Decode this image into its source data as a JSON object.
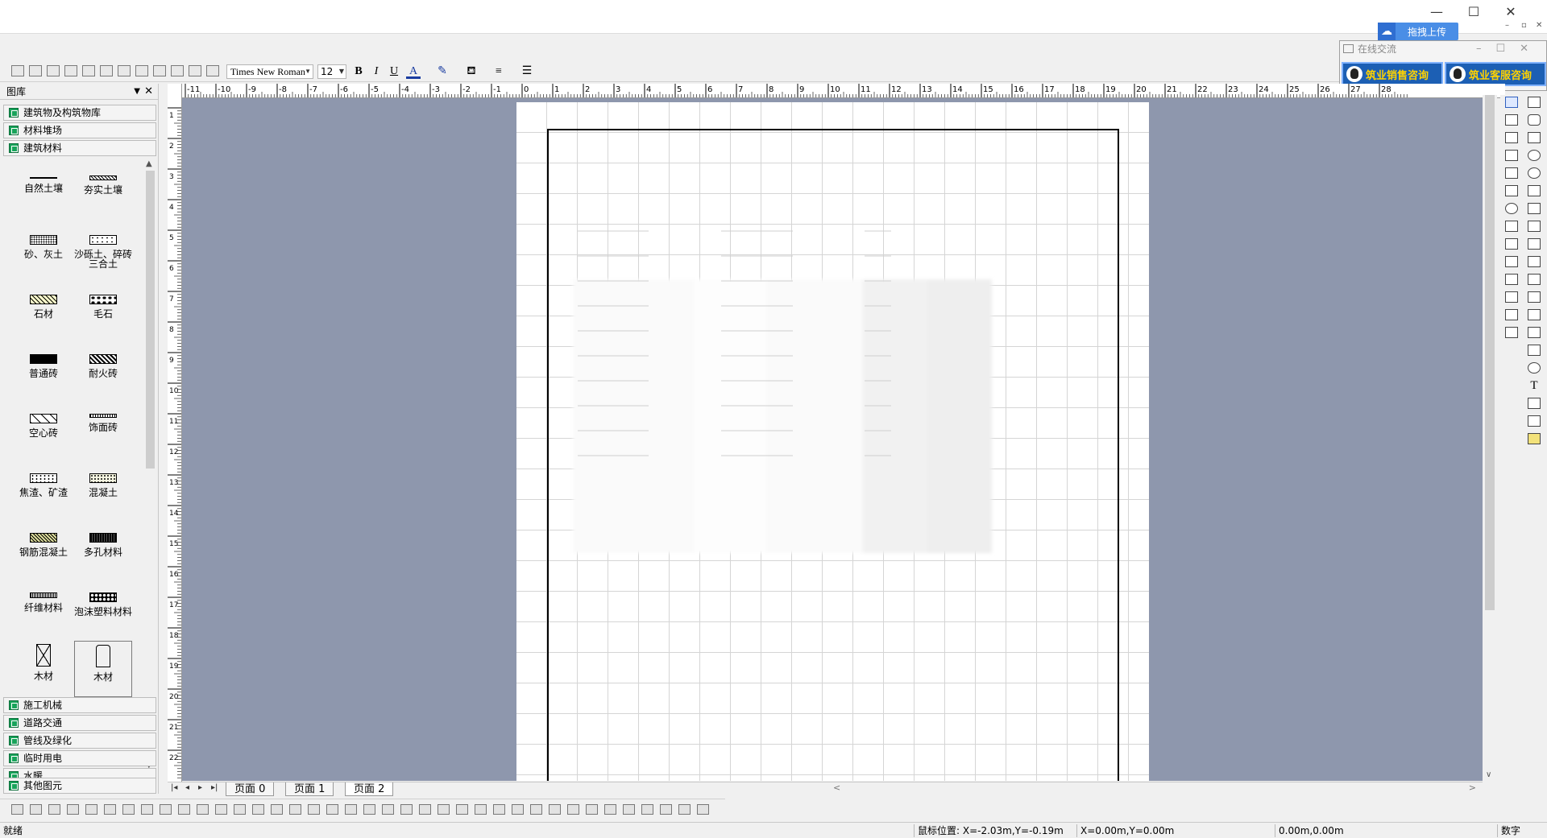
{
  "titlebar": {
    "upload_label": "拖拽上传",
    "minimize": "—",
    "maximize": "☐",
    "close": "✕"
  },
  "toolbar": {
    "font_name": "Times New Roman",
    "font_size": "12",
    "bold": "B",
    "italic": "I",
    "underline": "U",
    "font_color": "A"
  },
  "online": {
    "title": "在线交流",
    "sales": "筑业销售咨询",
    "service": "筑业客服咨询"
  },
  "library": {
    "title": "图库",
    "categories_top": [
      "建筑物及构筑物库",
      "材料堆场",
      "建筑材料"
    ],
    "symbols": [
      {
        "label": "自然土壤"
      },
      {
        "label": "夯实土壤"
      },
      {
        "label": "砂、灰土"
      },
      {
        "label": "沙砾土、碎砖三合土"
      },
      {
        "label": "石材"
      },
      {
        "label": "毛石"
      },
      {
        "label": "普通砖"
      },
      {
        "label": "耐火砖"
      },
      {
        "label": "空心砖"
      },
      {
        "label": "饰面砖"
      },
      {
        "label": "焦渣、矿渣"
      },
      {
        "label": "混凝土"
      },
      {
        "label": "钢筋混凝土"
      },
      {
        "label": "多孔材料"
      },
      {
        "label": "纤维材料"
      },
      {
        "label": "泡沫塑料材料"
      },
      {
        "label": "木材"
      },
      {
        "label": "木材"
      }
    ],
    "categories_bottom": [
      "施工机械",
      "道路交通",
      "管线及绿化",
      "临时用电",
      "水暖",
      "其他图元"
    ]
  },
  "ruler_h_labels": [
    "-11",
    "-10",
    "-9",
    "-8",
    "-7",
    "-6",
    "-5",
    "-4",
    "-3",
    "-2",
    "-1",
    "0",
    "1",
    "2",
    "3",
    "4",
    "5",
    "6",
    "7",
    "8",
    "9",
    "10",
    "11",
    "12",
    "13",
    "14",
    "15",
    "16",
    "17",
    "18",
    "19",
    "20",
    "21",
    "22",
    "23",
    "24",
    "25",
    "26",
    "27",
    "28"
  ],
  "ruler_v_labels": [
    "1",
    "2",
    "3",
    "4",
    "5",
    "6",
    "7",
    "8",
    "9",
    "10",
    "11",
    "12",
    "13",
    "14",
    "15",
    "16",
    "17",
    "18",
    "19",
    "20",
    "21",
    "22"
  ],
  "tabs": {
    "items": [
      {
        "label": "页面 0"
      },
      {
        "label": "页面 1"
      },
      {
        "label": "页面 2"
      }
    ],
    "active_index": 2
  },
  "status": {
    "ready": "就绪",
    "mouse_pos": "鼠标位置: X=-2.03m,Y=-0.19m",
    "xy": "X=0.00m,Y=0.00m",
    "size": "0.00m,0.00m",
    "numlock": "数字"
  }
}
